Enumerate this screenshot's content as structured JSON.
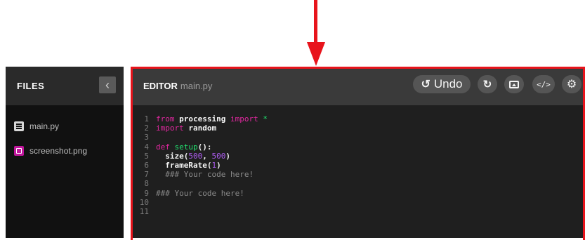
{
  "files_panel": {
    "title": "FILES",
    "collapse_icon": "chevron-left-icon",
    "files": [
      {
        "name": "main.py",
        "icon": "python-file-icon"
      },
      {
        "name": "screenshot.png",
        "icon": "image-file-icon"
      }
    ]
  },
  "editor": {
    "label": "EDITOR",
    "filename": "main.py",
    "toolbar": {
      "undo_label": "Undo",
      "undo_icon": "undo-icon",
      "redo_icon": "redo-icon",
      "image_icon": "image-icon",
      "code_icon_text": "</>",
      "settings_icon": "gear-icon"
    },
    "code_lines": [
      {
        "n": "1",
        "segments": [
          [
            "kw",
            "from "
          ],
          [
            "bd",
            "processing "
          ],
          [
            "kw",
            "import "
          ],
          [
            "str",
            "*"
          ]
        ]
      },
      {
        "n": "2",
        "segments": [
          [
            "kw",
            "import "
          ],
          [
            "bd",
            "random"
          ]
        ]
      },
      {
        "n": "3",
        "segments": []
      },
      {
        "n": "4",
        "segments": [
          [
            "kw",
            "def "
          ],
          [
            "fn",
            "setup"
          ],
          [
            "bd",
            "():"
          ]
        ]
      },
      {
        "n": "5",
        "segments": [
          [
            "bd",
            "  size("
          ],
          [
            "num",
            "500"
          ],
          [
            "bd",
            ", "
          ],
          [
            "num",
            "500"
          ],
          [
            "bd",
            ")"
          ]
        ]
      },
      {
        "n": "6",
        "segments": [
          [
            "bd",
            "  frameRate("
          ],
          [
            "num",
            "1"
          ],
          [
            "bd",
            ")"
          ]
        ]
      },
      {
        "n": "7",
        "segments": [
          [
            "cm",
            "  ### Your code here!"
          ]
        ]
      },
      {
        "n": "8",
        "segments": []
      },
      {
        "n": "9",
        "segments": [
          [
            "cm",
            "### Your code here!"
          ]
        ]
      },
      {
        "n": "10",
        "segments": []
      },
      {
        "n": "11",
        "segments": []
      }
    ]
  },
  "colors": {
    "highlight": "#e8141c",
    "keyword": "#e0279f",
    "string": "#21e36f",
    "number": "#ad5cf0"
  }
}
